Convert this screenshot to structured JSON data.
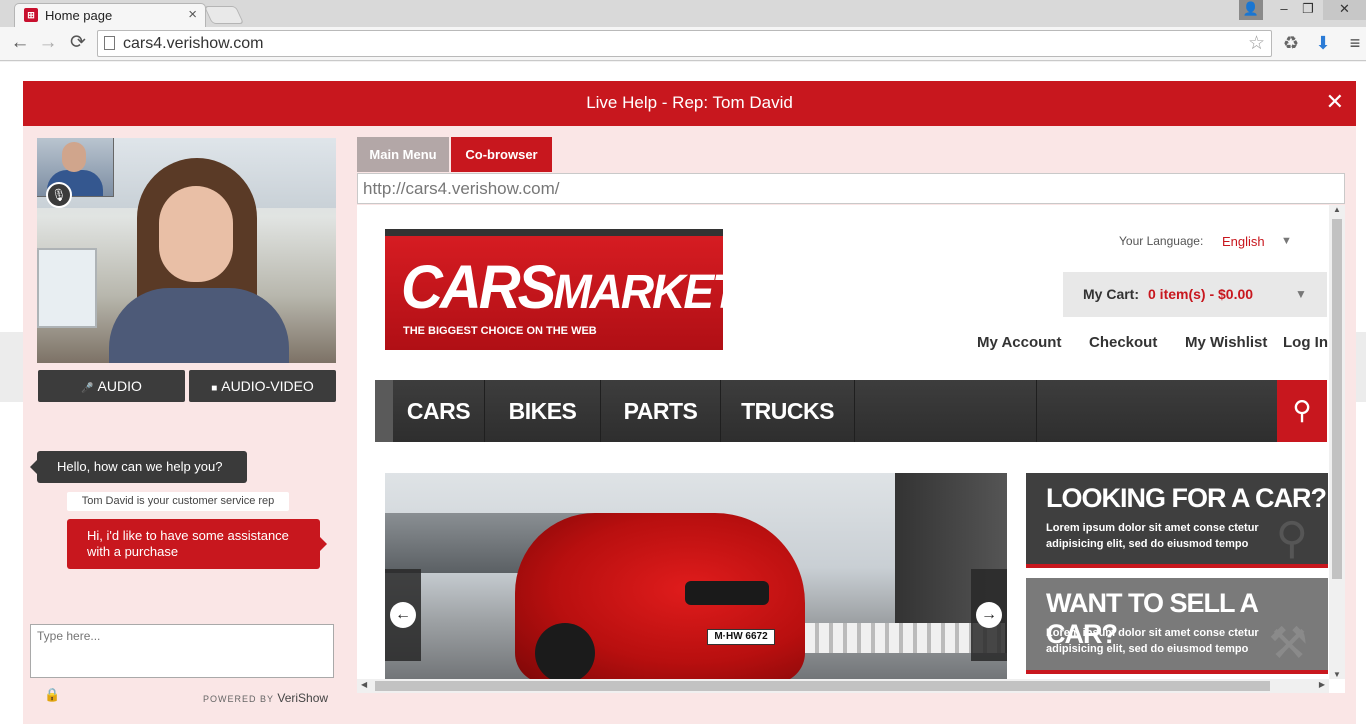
{
  "browser": {
    "tab_title": "Home page",
    "tab_close": "×",
    "url": "cars4.verishow.com",
    "back": "←",
    "forward": "→",
    "reload": "⟳",
    "star": "☆",
    "menu": "≡"
  },
  "window_controls": {
    "user": "👤",
    "minimize": "–",
    "maximize": "❐",
    "close": "✕"
  },
  "modal": {
    "title": "Live Help - Rep: Tom David",
    "close": "✕"
  },
  "av_buttons": {
    "audio": "AUDIO",
    "audio_video": "AUDIO-VIDEO"
  },
  "chat": {
    "rep_message": "Hello, how can we help you?",
    "note": "Tom David is your customer service rep",
    "user_message": "Hi, i'd like to have some assistance with a purchase",
    "input_placeholder": "Type here...",
    "powered_label": "POWERED BY",
    "powered_brand": "VeriShow"
  },
  "cobrowser": {
    "tab_main": "Main Menu",
    "tab_cobrowse": "Co-browser",
    "url": "http://cars4.verishow.com/"
  },
  "site": {
    "logo_big": "CARS",
    "logo_small": "MARKET",
    "logo_tagline": "THE BIGGEST CHOICE ON THE WEB",
    "language_label": "Your Language:",
    "language_value": "English",
    "cart_label": "My Cart:",
    "cart_value": "0 item(s) - $0.00",
    "links": {
      "account": "My Account",
      "checkout": "Checkout",
      "wishlist": "My Wishlist",
      "login": "Log In"
    },
    "nav": {
      "cars": "CARS",
      "bikes": "BIKES",
      "parts": "PARTS",
      "trucks": "TRUCKS"
    },
    "plate": "M·HW 6672",
    "promo1_title": "LOOKING FOR A CAR?",
    "promo1_text": "Lorem ipsum dolor sit amet conse ctetur adipisicing elit, sed do eiusmod tempo",
    "promo2_title": "WANT TO SELL A CAR?",
    "promo2_text": "Lorem ipsum dolor sit amet conse ctetur adipisicing elit, sed do eiusmod tempo"
  },
  "colors": {
    "brand_red": "#c8171e",
    "dark": "#3a3a3a"
  }
}
